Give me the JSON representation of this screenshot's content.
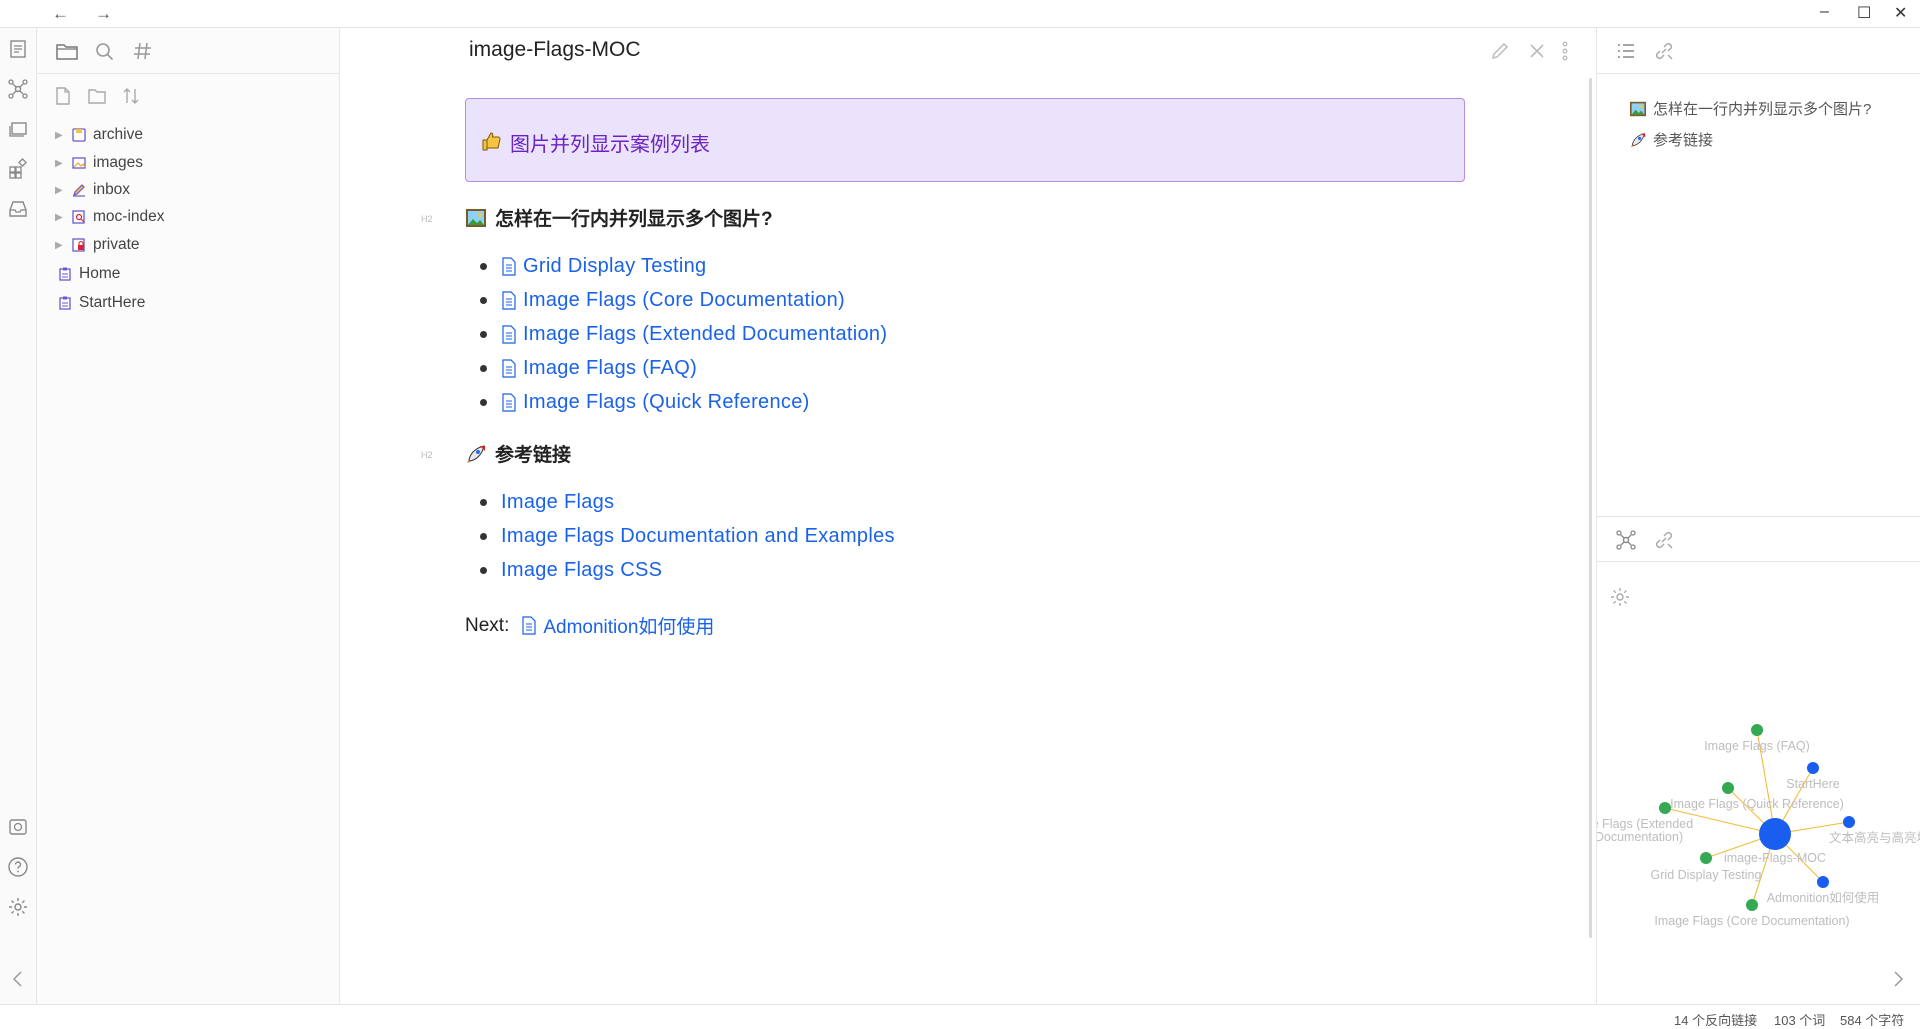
{
  "window": {
    "back_label": "←",
    "forward_label": "→",
    "minimize": "–",
    "maximize": "☐",
    "close": "✕"
  },
  "tree": [
    {
      "label": "archive",
      "folder": true,
      "icon": "floppy-icon"
    },
    {
      "label": "images",
      "folder": true,
      "icon": "image-icon"
    },
    {
      "label": "inbox",
      "folder": true,
      "icon": "pencil-icon"
    },
    {
      "label": "moc-index",
      "folder": true,
      "icon": "magnifier-doc-icon"
    },
    {
      "label": "private",
      "folder": true,
      "icon": "lock-doc-icon"
    },
    {
      "label": "Home",
      "folder": false,
      "icon": "clipboard-icon"
    },
    {
      "label": "StartHere",
      "folder": false,
      "icon": "clipboard-icon"
    }
  ],
  "note": {
    "title": "image-Flags-MOC",
    "callout": "图片并列显示案例列表",
    "h2_tag": "H2",
    "section1": {
      "heading": "怎样在一行内并列显示多个图片?",
      "items": [
        "Grid Display Testing",
        "Image Flags (Core Documentation)",
        "Image Flags (Extended Documentation)",
        "Image Flags (FAQ)",
        "Image Flags (Quick Reference)"
      ]
    },
    "section2": {
      "heading": "参考链接",
      "items": [
        "Image Flags",
        "Image Flags Documentation and Examples",
        "Image Flags CSS"
      ]
    },
    "next_label": "Next:",
    "next_link": "Admonition如何使用"
  },
  "outline": [
    {
      "label": "怎样在一行内并列显示多个图片?",
      "icon": "picture-icon"
    },
    {
      "label": "参考链接",
      "icon": "rocket-icon"
    }
  ],
  "graph": {
    "center": "image-Flags-MOC",
    "nodes": [
      {
        "label": "Image Flags (FAQ)",
        "color": "#34a853"
      },
      {
        "label": "StartHere",
        "color": "#1a5ef0"
      },
      {
        "label": "Image Flags (Quick Reference)",
        "color": "#34a853"
      },
      {
        "label": "ge Flags (Extended",
        "label2": "Documentation)",
        "color": "#34a853"
      },
      {
        "label": "文本高亮与高亮块",
        "color": "#1a5ef0"
      },
      {
        "label": "Grid Display Testing",
        "color": "#34a853"
      },
      {
        "label": "Admonition如何使用",
        "color": "#1a5ef0"
      },
      {
        "label": "Image Flags (Core Documentation)",
        "color": "#34a853"
      }
    ]
  },
  "status": {
    "backlinks": "14 个反向链接",
    "words": "103 个词",
    "chars": "584 个字符"
  },
  "colors": {
    "accent": "#1a62e8",
    "callout_bg": "#ebe3fb",
    "callout_border": "#b58ce8",
    "callout_text": "#6a24c2",
    "graph_link": "#f2bd35"
  }
}
